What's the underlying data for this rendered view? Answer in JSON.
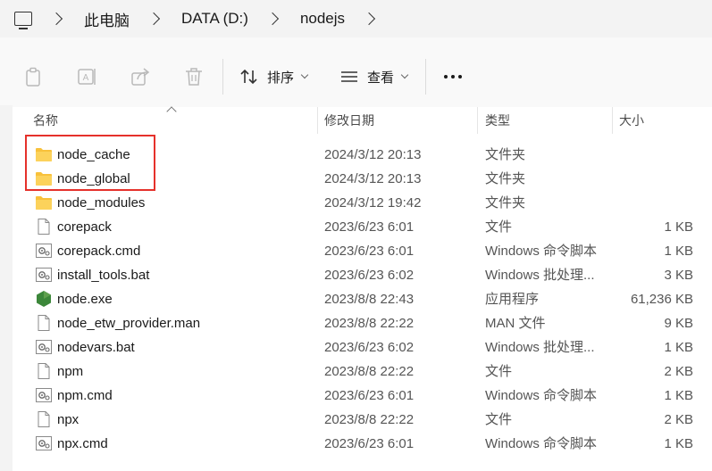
{
  "breadcrumb": {
    "items": [
      "此电脑",
      "DATA (D:)",
      "nodejs"
    ]
  },
  "toolbar": {
    "sort_label": "排序",
    "view_label": "查看",
    "icons": [
      "copy-icon",
      "rename-icon",
      "share-icon",
      "delete-icon",
      "sort-icon",
      "view-icon",
      "more-icon"
    ]
  },
  "columns": {
    "name": "名称",
    "date": "修改日期",
    "type": "类型",
    "size": "大小"
  },
  "files": [
    {
      "name": "node_cache",
      "date": "2024/3/12 20:13",
      "type": "文件夹",
      "size": "",
      "icon": "folder-icon"
    },
    {
      "name": "node_global",
      "date": "2024/3/12 20:13",
      "type": "文件夹",
      "size": "",
      "icon": "folder-icon"
    },
    {
      "name": "node_modules",
      "date": "2024/3/12 19:42",
      "type": "文件夹",
      "size": "",
      "icon": "folder-icon"
    },
    {
      "name": "corepack",
      "date": "2023/6/23 6:01",
      "type": "文件",
      "size": "1 KB",
      "icon": "file-icon"
    },
    {
      "name": "corepack.cmd",
      "date": "2023/6/23 6:01",
      "type": "Windows 命令脚本",
      "size": "1 KB",
      "icon": "script-icon"
    },
    {
      "name": "install_tools.bat",
      "date": "2023/6/23 6:02",
      "type": "Windows 批处理...",
      "size": "3 KB",
      "icon": "script-icon"
    },
    {
      "name": "node.exe",
      "date": "2023/8/8 22:43",
      "type": "应用程序",
      "size": "61,236 KB",
      "icon": "nodejs-icon"
    },
    {
      "name": "node_etw_provider.man",
      "date": "2023/8/8 22:22",
      "type": "MAN 文件",
      "size": "9 KB",
      "icon": "file-icon"
    },
    {
      "name": "nodevars.bat",
      "date": "2023/6/23 6:02",
      "type": "Windows 批处理...",
      "size": "1 KB",
      "icon": "script-icon"
    },
    {
      "name": "npm",
      "date": "2023/8/8 22:22",
      "type": "文件",
      "size": "2 KB",
      "icon": "file-icon"
    },
    {
      "name": "npm.cmd",
      "date": "2023/6/23 6:01",
      "type": "Windows 命令脚本",
      "size": "1 KB",
      "icon": "script-icon"
    },
    {
      "name": "npx",
      "date": "2023/8/8 22:22",
      "type": "文件",
      "size": "2 KB",
      "icon": "file-icon"
    },
    {
      "name": "npx.cmd",
      "date": "2023/6/23 6:01",
      "type": "Windows 命令脚本",
      "size": "1 KB",
      "icon": "script-icon"
    }
  ],
  "colors": {
    "highlight_border": "#e5312b",
    "folder": "#f8c13b",
    "nodejs": "#3c873a"
  }
}
